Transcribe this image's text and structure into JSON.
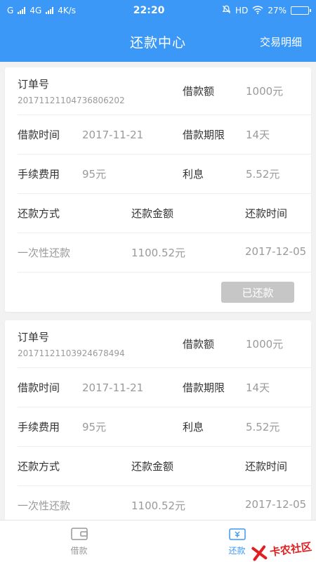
{
  "status": {
    "carrier": "G",
    "network": "4G",
    "speed": "4K/s",
    "time": "22:20",
    "hd": "HD",
    "battery": "27%",
    "battery_level": 0.27
  },
  "header": {
    "title": "还款中心",
    "detail_link": "交易明细",
    "color": "#3b98f6"
  },
  "labels": {
    "order_no": "订单号",
    "loan_amount": "借款额",
    "loan_time": "借款时间",
    "loan_term": "借款期限",
    "fee": "手续费用",
    "interest": "利息",
    "repay_method": "还款方式",
    "repay_amount": "还款金额",
    "repay_time": "还款时间"
  },
  "orders": [
    {
      "order_no": "20171121104736806202",
      "loan_amount": "1000元",
      "loan_time": "2017-11-21",
      "loan_term": "14天",
      "fee": "95元",
      "interest": "5.52元",
      "repay_method": "一次性还款",
      "repay_amount": "1100.52元",
      "repay_time": "2017-12-05",
      "status_button": "已还款"
    },
    {
      "order_no": "20171121103924678494",
      "loan_amount": "1000元",
      "loan_time": "2017-11-21",
      "loan_term": "14天",
      "fee": "95元",
      "interest": "5.52元",
      "repay_method": "一次性还款",
      "repay_amount": "1100.52元",
      "repay_time": "2017-12-05"
    }
  ],
  "tabbar": {
    "tabs": [
      {
        "label": "借款",
        "icon": "wallet-icon"
      },
      {
        "label": "还款",
        "icon": "repay-icon"
      }
    ]
  },
  "watermark": {
    "text": "卡农社区"
  }
}
